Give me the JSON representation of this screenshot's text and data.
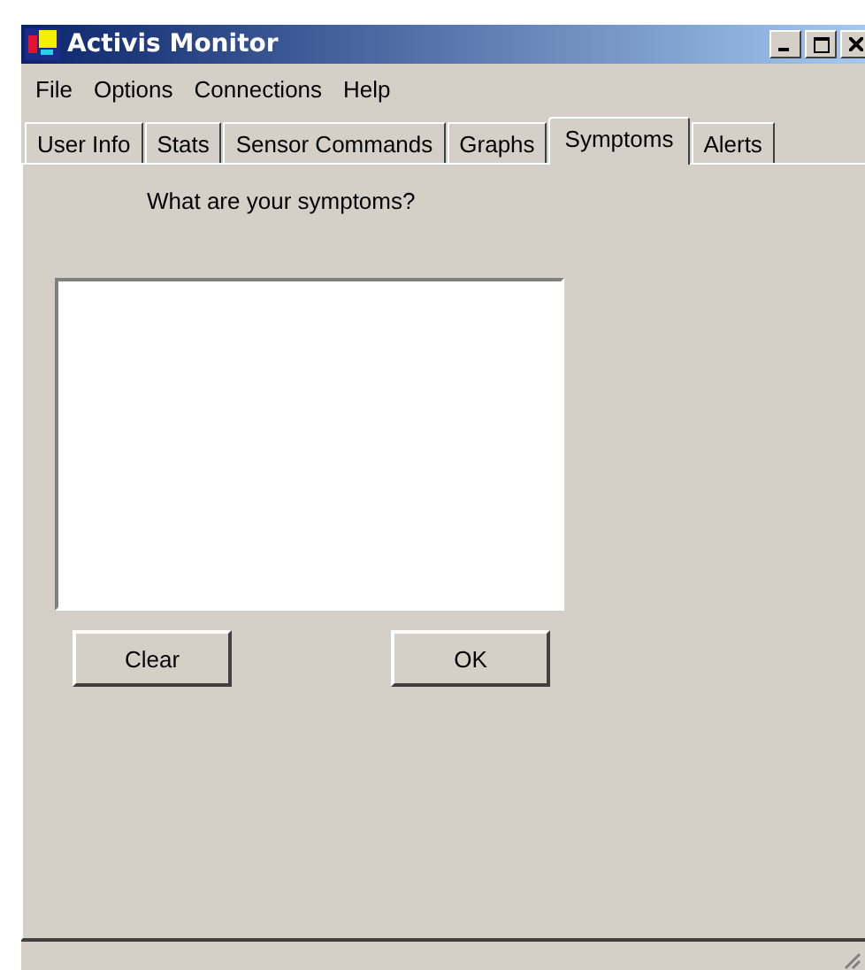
{
  "window": {
    "title": "Activis Monitor"
  },
  "menu": [
    "File",
    "Options",
    "Connections",
    "Help"
  ],
  "tabs": [
    {
      "label": "User Info",
      "selected": false
    },
    {
      "label": "Stats",
      "selected": false
    },
    {
      "label": "Sensor Commands",
      "selected": false
    },
    {
      "label": "Graphs",
      "selected": false
    },
    {
      "label": "Symptoms",
      "selected": true
    },
    {
      "label": "Alerts",
      "selected": false
    }
  ],
  "prompt": "What are your symptoms?",
  "buttons": [
    "Clear",
    "OK"
  ]
}
